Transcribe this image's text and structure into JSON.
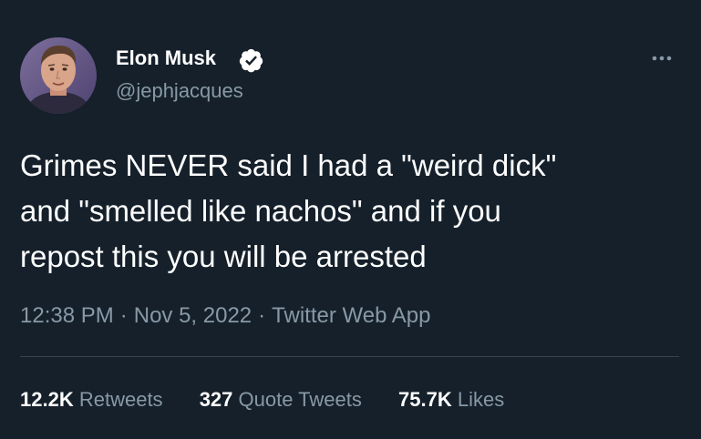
{
  "author": {
    "name": "Elon Musk",
    "handle": "@jephjacques",
    "verified_icon": "verified-badge-icon",
    "avatar_icon": "profile-photo"
  },
  "tweet": {
    "lines": [
      "Grimes NEVER said I had a \"weird dick\"",
      "and \"smelled like nachos\" and if you",
      "repost this you will be arrested"
    ]
  },
  "meta": {
    "time": "12:38 PM",
    "separator": "·",
    "date": "Nov 5, 2022",
    "source": "Twitter Web App"
  },
  "stats": {
    "retweets": {
      "count": "12.2K",
      "label": "Retweets"
    },
    "quotes": {
      "count": "327",
      "label": "Quote Tweets"
    },
    "likes": {
      "count": "75.7K",
      "label": "Likes"
    }
  },
  "more_icon": "more-horizontal-icon",
  "colors": {
    "background": "#15202b",
    "text": "#ffffff",
    "secondary_text": "#8899a6",
    "divider": "#38444d"
  }
}
